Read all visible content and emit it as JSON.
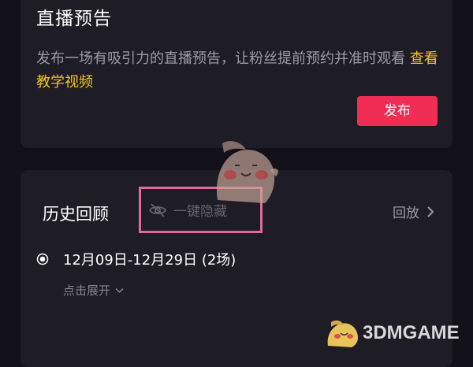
{
  "preview": {
    "title": "直播预告",
    "description": "发布一场有吸引力的直播预告，让粉丝提前预约并准时观看",
    "tutorial_link": "查看教学视频",
    "publish_label": "发布"
  },
  "history": {
    "title": "历史回顾",
    "hide_all_label": "一键隐藏",
    "replay_label": "回放",
    "period_label": "12月09日-12月29日 (2场)",
    "expand_label": "点击展开"
  },
  "watermark": {
    "site_name": "3DMGAME"
  },
  "colors": {
    "accent_button": "#ef2d55",
    "link": "#f2c41f",
    "highlight_box": "#e06b98",
    "card_background": "#1e1d26",
    "page_background": "#121119"
  },
  "icons": {
    "hide": "eye-off-icon",
    "replay": "chevron-right-icon",
    "period": "radio-selected-icon",
    "expand": "chevron-down-icon"
  }
}
